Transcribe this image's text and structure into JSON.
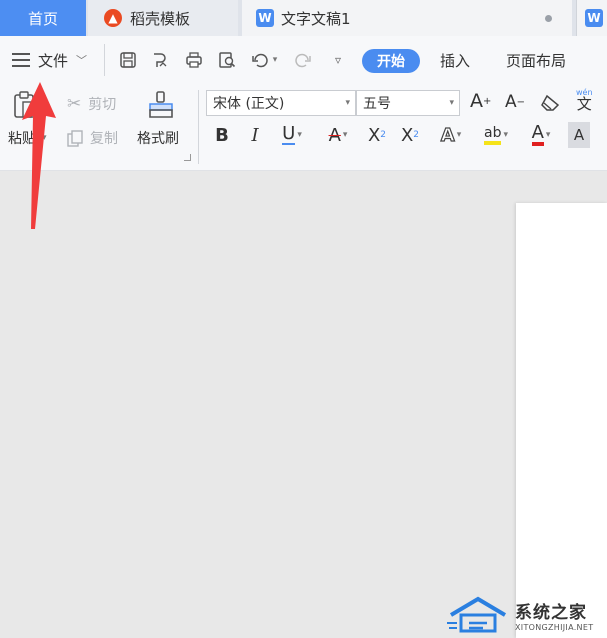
{
  "tabs": [
    {
      "label": "首页",
      "icon": "home"
    },
    {
      "label": "稻壳模板",
      "icon": "daoke-flame-icon"
    },
    {
      "label": "文字文稿1",
      "icon": "wps-writer-icon"
    }
  ],
  "menu": {
    "file_label": "文件",
    "items": [
      "开始",
      "插入",
      "页面布局"
    ],
    "active": "开始"
  },
  "clipboard": {
    "paste": "粘贴",
    "cut": "剪切",
    "copy": "复制",
    "format_painter": "格式刷"
  },
  "font": {
    "family": "宋体 (正文)",
    "size": "五号",
    "grow_glyph": "A",
    "shrink_glyph": "A",
    "pinyin": "wén",
    "pinyin_char": "文",
    "bold": "B",
    "italic": "I",
    "underline": "U",
    "strike": "A",
    "superscript_base": "X",
    "superscript_mark": "2",
    "subscript_base": "X",
    "subscript_mark": "2",
    "effect": "A",
    "highlight": "ab",
    "font_color": "A",
    "char_shade": "A"
  },
  "watermark": {
    "brand": "系统之家",
    "domain": "XITONGZHIJIA.NET"
  },
  "colors": {
    "accent": "#4a8cf0",
    "arrow": "#f03c3c",
    "highlight_bar": "#f5e31a",
    "font_color_bar": "#e02020"
  }
}
